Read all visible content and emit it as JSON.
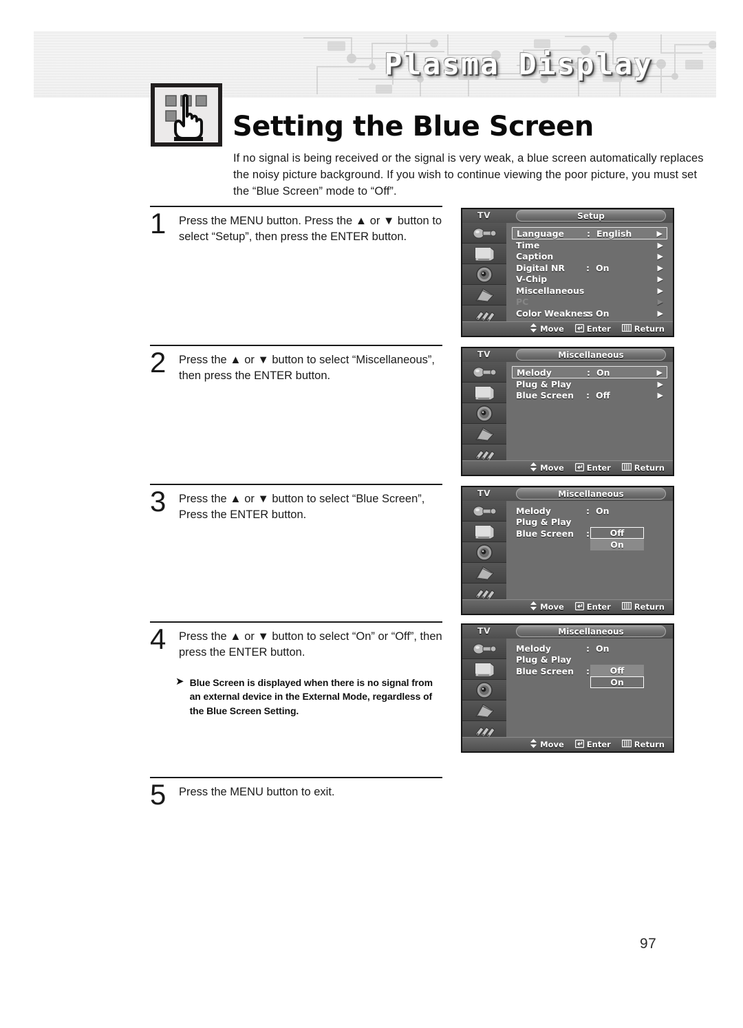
{
  "banner": {
    "brand": "Plasma Display"
  },
  "header": {
    "title": "Setting the Blue Screen",
    "icon": "hand-pressing-button-icon",
    "intro": "If no signal is being received or the signal is very weak, a blue screen automatically replaces the noisy picture background. If you wish to continue viewing the poor picture, you must set the “Blue Screen” mode to “Off”."
  },
  "steps": [
    {
      "number": "1",
      "text": "Press the MENU button. Press the ▲ or ▼ button to select “Setup”, then press the ENTER button."
    },
    {
      "number": "2",
      "text": "Press the ▲ or ▼ button to select “Miscellaneous”, then press the ENTER button."
    },
    {
      "number": "3",
      "text": "Press the ▲ or ▼ button to select “Blue Screen”, Press the ENTER button."
    },
    {
      "number": "4",
      "text": "Press the ▲ or ▼ button to select “On” or “Off”, then press the ENTER button."
    },
    {
      "number": "5",
      "text": "Press the MENU button to exit."
    }
  ],
  "note": {
    "marker": "➤",
    "text": "Blue Screen is displayed when there is no signal from an external device in the External Mode, regardless of the Blue Screen Setting."
  },
  "osd_common": {
    "source_label": "TV",
    "hints": [
      {
        "icon": "up-down-arrows-icon",
        "label": "Move"
      },
      {
        "icon": "enter-key-icon",
        "label": "Enter"
      },
      {
        "icon": "menu-bars-icon",
        "label": "Return"
      }
    ],
    "sidebar_icons": [
      "input-jack-icon",
      "picture-tv-icon",
      "sound-speaker-icon",
      "channel-antenna-icon",
      "setup-tools-icon"
    ]
  },
  "osd_panels": [
    {
      "title": "Setup",
      "rows": [
        {
          "label": "Language",
          "colon": ":",
          "value": "English",
          "arrow": "▶",
          "selected": true,
          "dim": false
        },
        {
          "label": "Time",
          "colon": "",
          "value": "",
          "arrow": "▶",
          "selected": false,
          "dim": false
        },
        {
          "label": "Caption",
          "colon": "",
          "value": "",
          "arrow": "▶",
          "selected": false,
          "dim": false
        },
        {
          "label": "Digital NR",
          "colon": ":",
          "value": "On",
          "arrow": "▶",
          "selected": false,
          "dim": false
        },
        {
          "label": "V-Chip",
          "colon": "",
          "value": "",
          "arrow": "▶",
          "selected": false,
          "dim": false
        },
        {
          "label": "Miscellaneous",
          "colon": "",
          "value": "",
          "arrow": "▶",
          "selected": false,
          "dim": false
        },
        {
          "label": "PC",
          "colon": "",
          "value": "",
          "arrow": "▶",
          "selected": false,
          "dim": true
        },
        {
          "label": "Color Weakness",
          "colon": ":",
          "value": "On",
          "arrow": "▶",
          "selected": false,
          "dim": false
        }
      ],
      "dropdown": null
    },
    {
      "title": "Miscellaneous",
      "rows": [
        {
          "label": "Melody",
          "colon": ":",
          "value": "On",
          "arrow": "▶",
          "selected": true,
          "dim": false
        },
        {
          "label": "Plug & Play",
          "colon": "",
          "value": "",
          "arrow": "▶",
          "selected": false,
          "dim": false
        },
        {
          "label": "Blue Screen",
          "colon": ":",
          "value": "Off",
          "arrow": "▶",
          "selected": false,
          "dim": false
        }
      ],
      "dropdown": null
    },
    {
      "title": "Miscellaneous",
      "rows": [
        {
          "label": "Melody",
          "colon": ":",
          "value": "On",
          "arrow": "",
          "selected": false,
          "dim": false
        },
        {
          "label": "Plug & Play",
          "colon": "",
          "value": "",
          "arrow": "",
          "selected": false,
          "dim": false
        },
        {
          "label": "Blue Screen",
          "colon": ":",
          "value": "",
          "arrow": "",
          "selected": false,
          "dim": false
        }
      ],
      "dropdown": {
        "options": [
          "Off",
          "On"
        ],
        "selected_index": 0
      }
    },
    {
      "title": "Miscellaneous",
      "rows": [
        {
          "label": "Melody",
          "colon": ":",
          "value": "On",
          "arrow": "",
          "selected": false,
          "dim": false
        },
        {
          "label": "Plug & Play",
          "colon": "",
          "value": "",
          "arrow": "",
          "selected": false,
          "dim": false
        },
        {
          "label": "Blue Screen",
          "colon": ":",
          "value": "",
          "arrow": "",
          "selected": false,
          "dim": false
        }
      ],
      "dropdown": {
        "options": [
          "Off",
          "On"
        ],
        "selected_index": 1
      }
    }
  ],
  "footer": {
    "page_number": "97"
  }
}
